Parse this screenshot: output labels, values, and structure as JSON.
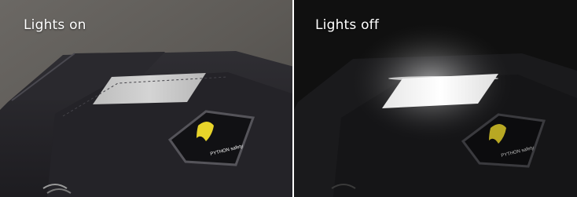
{
  "panels": {
    "left": {
      "caption": "Lights on"
    },
    "right": {
      "caption": "Lights off"
    }
  },
  "logo": {
    "text": "PYTHON safety"
  },
  "colors": {
    "left_bg": "#5e5b57",
    "right_bg": "#111111",
    "reflective": "#c9c9c9",
    "logo_yellow": "#e8d42a",
    "caption": "#ffffff"
  }
}
